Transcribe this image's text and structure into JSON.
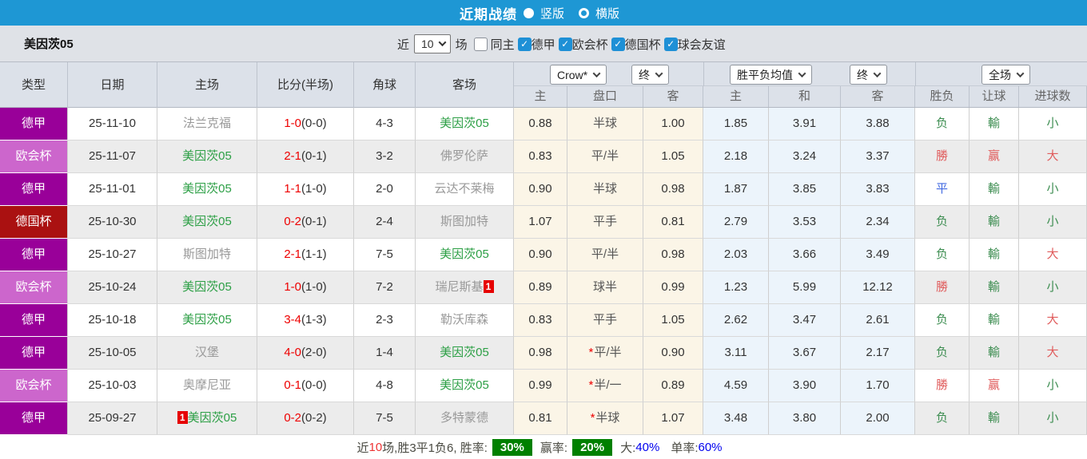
{
  "colors": {
    "topbar_bg": "#1e97d4",
    "league_colors": {
      "德甲": "#990099",
      "欧会杯": "#cc66cc",
      "德国杯": "#aa1111"
    },
    "green": "#3e8e52",
    "red": "#e05c5c",
    "blue": "#4169e1",
    "score_red": "#ee0000",
    "team_green": "#2c9f45",
    "team_gray": "#999999",
    "badge_red": "#e60000",
    "rate_bg_green": "#008000",
    "rate_blue": "#0000ee"
  },
  "topbar": {
    "title": "近期战绩",
    "vertical_label": "竖版",
    "horizontal_label": "横版"
  },
  "filter": {
    "team": "美因茨05",
    "near_label": "近",
    "count": "10",
    "games_label": "场",
    "same_home_label": "同主",
    "same_home_checked": false,
    "leagues": [
      {
        "label": "德甲",
        "checked": true
      },
      {
        "label": "欧会杯",
        "checked": true
      },
      {
        "label": "德国杯",
        "checked": true
      },
      {
        "label": "球会友谊",
        "checked": true
      }
    ]
  },
  "table": {
    "left_headers": [
      "类型",
      "日期",
      "主场",
      "比分(半场)",
      "角球",
      "客场"
    ],
    "dropdowns": [
      {
        "label": "Crow*"
      },
      {
        "label": "终"
      },
      {
        "label": "胜平负均值"
      },
      {
        "label": "终"
      },
      {
        "label": "全场"
      }
    ],
    "sub_headers": [
      "主",
      "盘口",
      "客",
      "主",
      "和",
      "客",
      "胜负",
      "让球",
      "进球数"
    ],
    "rows": [
      {
        "league": "德甲",
        "date": "25-11-10",
        "home": {
          "name": "法兰克福",
          "green": false
        },
        "score": "1-0",
        "half": "(0-0)",
        "corner": "4-3",
        "away": {
          "name": "美因茨05",
          "green": true
        },
        "crow": [
          "0.88",
          "半球",
          "1.00"
        ],
        "crow_star": false,
        "avg": [
          "1.85",
          "3.91",
          "3.88"
        ],
        "result": {
          "text": "负",
          "color": "green"
        },
        "handicap": {
          "text": "輸",
          "color": "green"
        },
        "goals": {
          "text": "小",
          "color": "green"
        }
      },
      {
        "league": "欧会杯",
        "date": "25-11-07",
        "home": {
          "name": "美因茨05",
          "green": true
        },
        "score": "2-1",
        "half": "(0-1)",
        "corner": "3-2",
        "away": {
          "name": "佛罗伦萨",
          "green": false
        },
        "crow": [
          "0.83",
          "平/半",
          "1.05"
        ],
        "crow_star": false,
        "avg": [
          "2.18",
          "3.24",
          "3.37"
        ],
        "result": {
          "text": "勝",
          "color": "red"
        },
        "handicap": {
          "text": "赢",
          "color": "red"
        },
        "goals": {
          "text": "大",
          "color": "red"
        }
      },
      {
        "league": "德甲",
        "date": "25-11-01",
        "home": {
          "name": "美因茨05",
          "green": true
        },
        "score": "1-1",
        "half": "(1-0)",
        "corner": "2-0",
        "away": {
          "name": "云达不莱梅",
          "green": false
        },
        "crow": [
          "0.90",
          "半球",
          "0.98"
        ],
        "crow_star": false,
        "avg": [
          "1.87",
          "3.85",
          "3.83"
        ],
        "result": {
          "text": "平",
          "color": "blue"
        },
        "handicap": {
          "text": "輸",
          "color": "green"
        },
        "goals": {
          "text": "小",
          "color": "green"
        }
      },
      {
        "league": "德国杯",
        "date": "25-10-30",
        "home": {
          "name": "美因茨05",
          "green": true
        },
        "score": "0-2",
        "half": "(0-1)",
        "corner": "2-4",
        "away": {
          "name": "斯图加特",
          "green": false
        },
        "crow": [
          "1.07",
          "平手",
          "0.81"
        ],
        "crow_star": false,
        "avg": [
          "2.79",
          "3.53",
          "2.34"
        ],
        "result": {
          "text": "负",
          "color": "green"
        },
        "handicap": {
          "text": "輸",
          "color": "green"
        },
        "goals": {
          "text": "小",
          "color": "green"
        }
      },
      {
        "league": "德甲",
        "date": "25-10-27",
        "home": {
          "name": "斯图加特",
          "green": false
        },
        "score": "2-1",
        "half": "(1-1)",
        "corner": "7-5",
        "away": {
          "name": "美因茨05",
          "green": true
        },
        "crow": [
          "0.90",
          "平/半",
          "0.98"
        ],
        "crow_star": false,
        "avg": [
          "2.03",
          "3.66",
          "3.49"
        ],
        "result": {
          "text": "负",
          "color": "green"
        },
        "handicap": {
          "text": "輸",
          "color": "green"
        },
        "goals": {
          "text": "大",
          "color": "red"
        }
      },
      {
        "league": "欧会杯",
        "date": "25-10-24",
        "home": {
          "name": "美因茨05",
          "green": true
        },
        "score": "1-0",
        "half": "(1-0)",
        "corner": "7-2",
        "away": {
          "name": "瑞尼斯基",
          "green": false,
          "badge": "1",
          "badge_after": true
        },
        "crow": [
          "0.89",
          "球半",
          "0.99"
        ],
        "crow_star": false,
        "avg": [
          "1.23",
          "5.99",
          "12.12"
        ],
        "result": {
          "text": "勝",
          "color": "red"
        },
        "handicap": {
          "text": "輸",
          "color": "green"
        },
        "goals": {
          "text": "小",
          "color": "green"
        }
      },
      {
        "league": "德甲",
        "date": "25-10-18",
        "home": {
          "name": "美因茨05",
          "green": true
        },
        "score": "3-4",
        "half": "(1-3)",
        "corner": "2-3",
        "away": {
          "name": "勒沃库森",
          "green": false
        },
        "crow": [
          "0.83",
          "平手",
          "1.05"
        ],
        "crow_star": false,
        "avg": [
          "2.62",
          "3.47",
          "2.61"
        ],
        "result": {
          "text": "负",
          "color": "green"
        },
        "handicap": {
          "text": "輸",
          "color": "green"
        },
        "goals": {
          "text": "大",
          "color": "red"
        }
      },
      {
        "league": "德甲",
        "date": "25-10-05",
        "home": {
          "name": "汉堡",
          "green": false
        },
        "score": "4-0",
        "half": "(2-0)",
        "corner": "1-4",
        "away": {
          "name": "美因茨05",
          "green": true
        },
        "crow": [
          "0.98",
          "平/半",
          "0.90"
        ],
        "crow_star": true,
        "avg": [
          "3.11",
          "3.67",
          "2.17"
        ],
        "result": {
          "text": "负",
          "color": "green"
        },
        "handicap": {
          "text": "輸",
          "color": "green"
        },
        "goals": {
          "text": "大",
          "color": "red"
        }
      },
      {
        "league": "欧会杯",
        "date": "25-10-03",
        "home": {
          "name": "奥摩尼亚",
          "green": false
        },
        "score": "0-1",
        "half": "(0-0)",
        "corner": "4-8",
        "away": {
          "name": "美因茨05",
          "green": true
        },
        "crow": [
          "0.99",
          "半/一",
          "0.89"
        ],
        "crow_star": true,
        "avg": [
          "4.59",
          "3.90",
          "1.70"
        ],
        "result": {
          "text": "勝",
          "color": "red"
        },
        "handicap": {
          "text": "赢",
          "color": "red"
        },
        "goals": {
          "text": "小",
          "color": "green"
        }
      },
      {
        "league": "德甲",
        "date": "25-09-27",
        "home": {
          "name": "美因茨05",
          "green": true,
          "badge": "1",
          "badge_after": false
        },
        "score": "0-2",
        "half": "(0-2)",
        "corner": "7-5",
        "away": {
          "name": "多特蒙德",
          "green": false
        },
        "crow": [
          "0.81",
          "半球",
          "1.07"
        ],
        "crow_star": true,
        "avg": [
          "3.48",
          "3.80",
          "2.00"
        ],
        "result": {
          "text": "负",
          "color": "green"
        },
        "handicap": {
          "text": "輸",
          "color": "green"
        },
        "goals": {
          "text": "小",
          "color": "green"
        }
      }
    ]
  },
  "summary": {
    "near_label": "近",
    "count": "10",
    "tail": "场,胜3平1负6, 胜率:",
    "win_rate": "30%",
    "handicap_label": "赢率:",
    "handicap_rate": "20%",
    "big_label": "大:",
    "big_rate": "40%",
    "single_label": "单率:",
    "single_rate": "60%"
  }
}
